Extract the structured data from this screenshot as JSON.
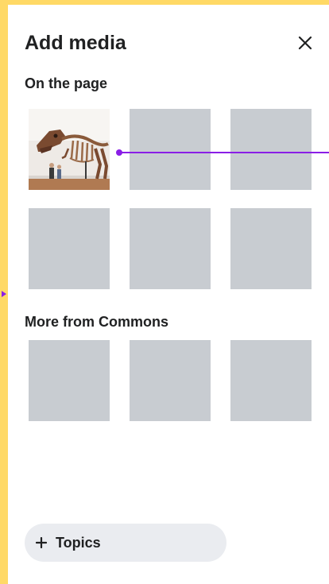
{
  "panel": {
    "title": "Add media",
    "close_icon": "close-icon"
  },
  "sections": {
    "on_page": {
      "label": "On the page",
      "items": [
        {
          "kind": "photo",
          "subject": "t-rex skeleton"
        },
        {
          "kind": "placeholder"
        },
        {
          "kind": "placeholder"
        },
        {
          "kind": "placeholder"
        },
        {
          "kind": "placeholder"
        },
        {
          "kind": "placeholder"
        }
      ]
    },
    "commons": {
      "label": "More from Commons",
      "items": [
        {
          "kind": "placeholder"
        },
        {
          "kind": "placeholder"
        },
        {
          "kind": "placeholder"
        }
      ]
    }
  },
  "topics_button": {
    "icon": "plus-icon",
    "label": "Topics"
  },
  "colors": {
    "frame": "#ffd966",
    "placeholder": "#c8ccd1",
    "annotation": "#8a1ee6",
    "text": "#202122",
    "pill": "#eaecf0"
  }
}
